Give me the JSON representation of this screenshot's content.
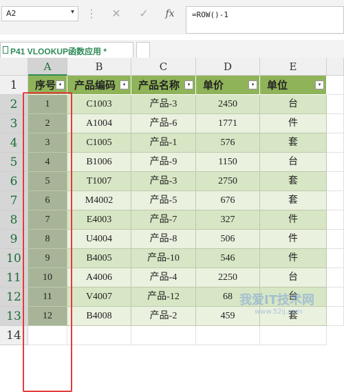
{
  "formula_bar": {
    "name_box": "A2",
    "name_box_arrow": "▾",
    "more_icon": "⋮",
    "cancel_icon": "✕",
    "confirm_icon": "✓",
    "fx_icon": "fx",
    "formula": "=ROW()-1"
  },
  "sheet_tabs": [
    {
      "label": "P41 VLOOKUP函数应用 *",
      "active": true
    }
  ],
  "columns": [
    "A",
    "B",
    "C",
    "D",
    "E"
  ],
  "rows": [
    "1",
    "2",
    "3",
    "4",
    "5",
    "6",
    "7",
    "8",
    "9",
    "10",
    "11",
    "12",
    "13",
    "14"
  ],
  "table": {
    "headers": [
      "序号",
      "产品编码",
      "产品名称",
      "单价",
      "单位"
    ],
    "filter_icon": "▾",
    "body": [
      [
        "1",
        "C1003",
        "产品-3",
        "2450",
        "台"
      ],
      [
        "2",
        "A1004",
        "产品-6",
        "1771",
        "件"
      ],
      [
        "3",
        "C1005",
        "产品-1",
        "576",
        "套"
      ],
      [
        "4",
        "B1006",
        "产品-9",
        "1150",
        "台"
      ],
      [
        "5",
        "T1007",
        "产品-3",
        "2750",
        "套"
      ],
      [
        "6",
        "M4002",
        "产品-5",
        "676",
        "套"
      ],
      [
        "7",
        "E4003",
        "产品-7",
        "327",
        "件"
      ],
      [
        "8",
        "U4004",
        "产品-8",
        "506",
        "件"
      ],
      [
        "9",
        "B4005",
        "产品-10",
        "546",
        "件"
      ],
      [
        "10",
        "A4006",
        "产品-4",
        "2250",
        "台"
      ],
      [
        "11",
        "V4007",
        "产品-12",
        "68",
        "台"
      ],
      [
        "12",
        "B4008",
        "产品-2",
        "459",
        "套"
      ]
    ]
  },
  "watermark": {
    "text": "我爱IT技术网",
    "sub": "www.52ij.com"
  },
  "colors": {
    "header_green": "#8fb359",
    "band_dark": "#d7e6c4",
    "band_light": "#eaf1df",
    "selection_red": "#e23b3b",
    "accent_green": "#2e8b57"
  }
}
